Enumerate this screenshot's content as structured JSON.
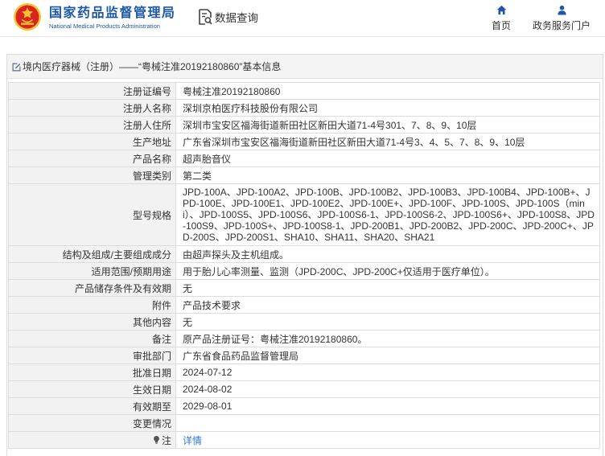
{
  "header": {
    "logo_icon": "nmpa-emblem",
    "org_name_cn": "国家药品监督管理局",
    "org_name_en": "National Medical Products Administration",
    "module_icon": "search-document-icon",
    "module_title": "数据查询",
    "nav": [
      {
        "label": "首页",
        "icon": "home-icon"
      },
      {
        "label": "政务服务门户",
        "icon": "user-icon"
      }
    ]
  },
  "section": {
    "icon": "edit-document-icon",
    "title": "境内医疗器械（注册）——“粤械注准20192180860”基本信息"
  },
  "details": [
    {
      "label": "注册证编号",
      "value": "粤械注准20192180860"
    },
    {
      "label": "注册人名称",
      "value": "深圳京柏医疗科技股份有限公司"
    },
    {
      "label": "注册人住所",
      "value": "深圳市宝安区福海街道新田社区新田大道71-4号301、7、8、9、10层"
    },
    {
      "label": "生产地址",
      "value": "广东省深圳市宝安区福海街道新田社区新田大道71-4号3、4、5、7、8、9、10层"
    },
    {
      "label": "产品名称",
      "value": "超声胎音仪"
    },
    {
      "label": "管理类别",
      "value": "第二类"
    },
    {
      "label": "型号规格",
      "value": "JPD-100A、JPD-100A2、JPD-100B、JPD-100B2、JPD-100B3、JPD-100B4、JPD-100B+、JPD-100E、JPD-100E1、JPD-100E2、JPD-100E+、JPD-100F、JPD-100S、JPD-100S（mini）、JPD-100S5、JPD-100S6、JPD-100S6-1、JPD-100S6-2、JPD-100S6+、JPD-100S8、JPD-100S9、JPD-100S+、JPD-100S8-1、JPD-200B1、JPD-200B2、JPD-200C、JPD-200C+、JPD-200S、JPD-200S1、SHA10、SHA11、SHA20、SHA21"
    },
    {
      "label": "结构及组成/主要组成成分",
      "value": "由超声探头及主机组成。"
    },
    {
      "label": "适用范围/预期用途",
      "value": "用于胎儿心率测量、监测（JPD-200C、JPD-200C+仅适用于医疗单位）。"
    },
    {
      "label": "产品储存条件及有效期",
      "value": "无"
    },
    {
      "label": "附件",
      "value": "产品技术要求"
    },
    {
      "label": "其他内容",
      "value": "无"
    },
    {
      "label": "备注",
      "value": "原产品注册证号：粤械注准20192180860。"
    },
    {
      "label": "审批部门",
      "value": "广东省食品药品监督管理局"
    },
    {
      "label": "批准日期",
      "value": "2024-07-12"
    },
    {
      "label": "生效日期",
      "value": "2024-08-02"
    },
    {
      "label": "有效期至",
      "value": "2029-08-01"
    },
    {
      "label": "变更情况",
      "value": ""
    }
  ],
  "note": {
    "icon": "lightbulb-icon",
    "label": "注",
    "link_text": "详情"
  },
  "colors": {
    "brand_blue": "#1d58a8",
    "link_blue": "#2f7bd3",
    "label_bg": "#f2f2f2"
  }
}
